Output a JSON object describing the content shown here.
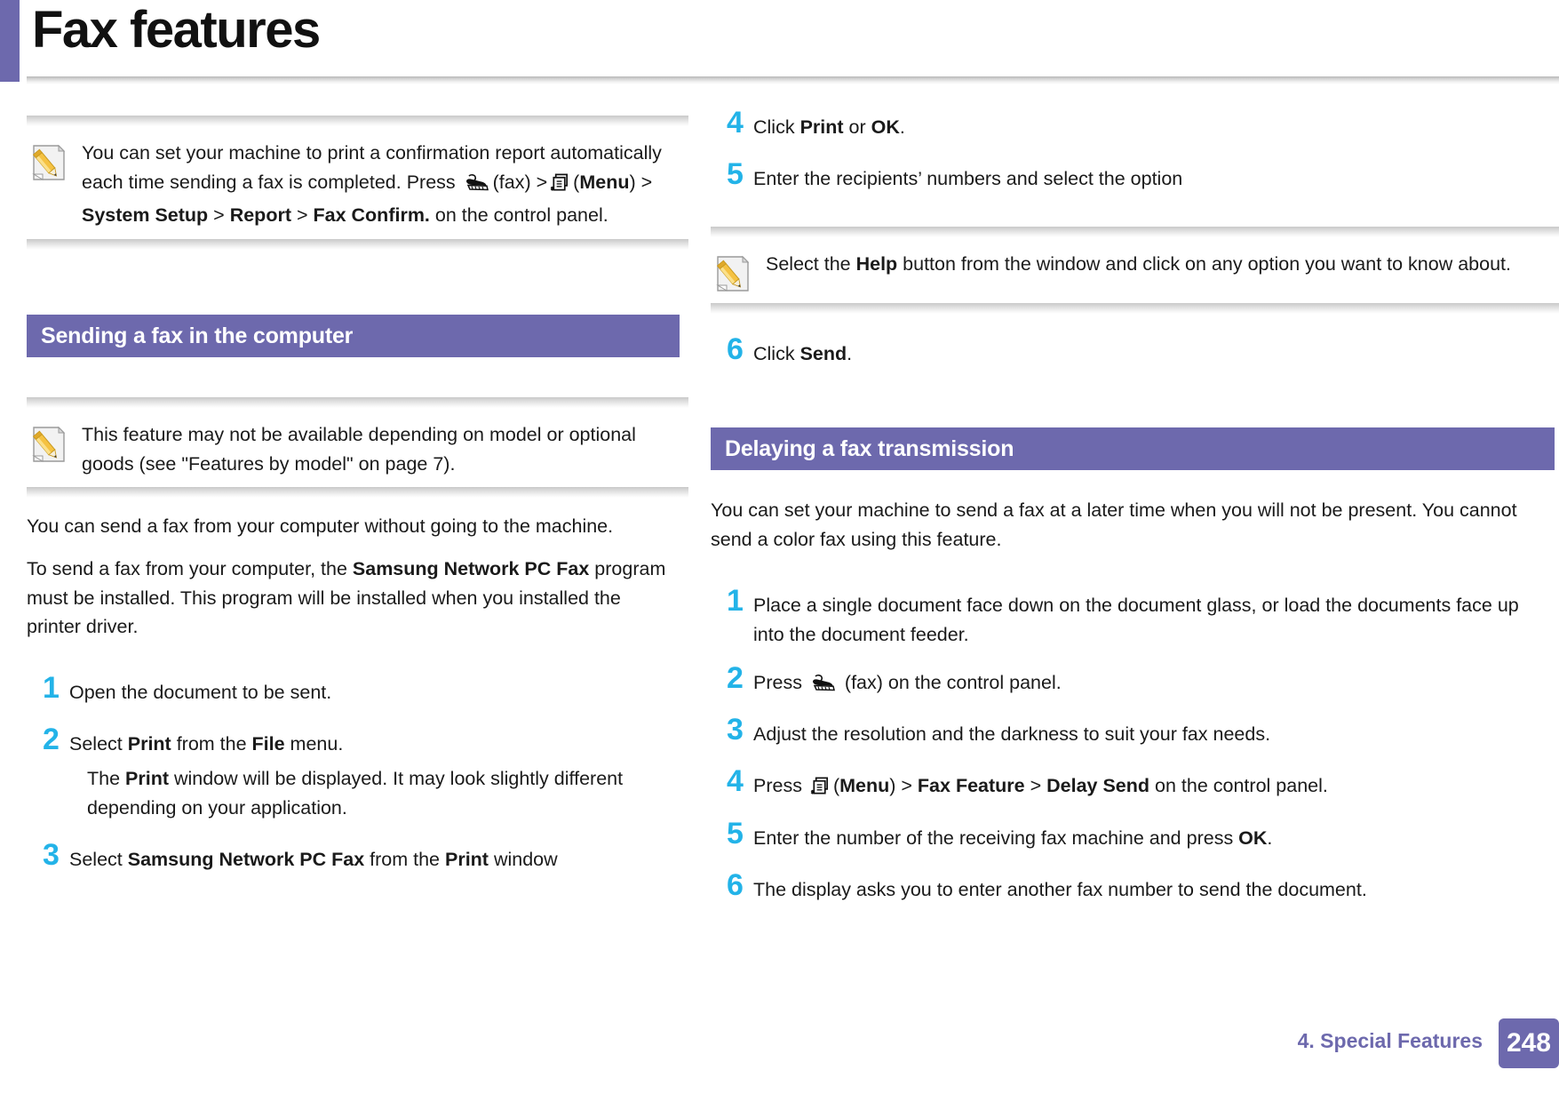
{
  "page": {
    "title": "Fax features",
    "accent_color": "#6d69ad",
    "step_number_color": "#23b3e8"
  },
  "notes": {
    "confirm_report": {
      "icon": "note-pencil-icon",
      "text_before_fax": "You can set your machine to print a confirmation report automatically each time sending a fax is completed. Press ",
      "fax_label": "(fax) >",
      "menu_label_open": "(",
      "menu_bold": "Menu",
      "menu_label_close": ") > ",
      "path_bold_1": "System Setup",
      "sep_1": " > ",
      "path_bold_2": "Report",
      "sep_2": " > ",
      "path_bold_3": "Fax Confirm.",
      "tail": " on the control panel."
    },
    "availability": {
      "icon": "note-pencil-icon",
      "text": "This feature may not be available depending on model or optional goods (see \"Features by model\" on page 7)."
    },
    "help_button": {
      "icon": "note-pencil-icon",
      "prefix": "Select the ",
      "bold": "Help",
      "suffix": " button from the window and click on any option you want to know about."
    }
  },
  "sections": {
    "sending_fax": {
      "heading": "Sending a fax in the computer",
      "paragraph_1": "You can send a fax from your computer without going to the machine.",
      "paragraph_2_prefix": "To send a fax from your computer, the ",
      "paragraph_2_bold": "Samsung Network PC Fax",
      "paragraph_2_suffix": " program must be installed. This program will be installed when you installed the printer driver.",
      "steps": [
        {
          "num": "1",
          "parts": [
            {
              "type": "plain",
              "text": "Open the document to be sent."
            }
          ]
        },
        {
          "num": "2",
          "parts": [
            {
              "type": "plain",
              "text": "Select "
            },
            {
              "type": "bold",
              "text": "Print"
            },
            {
              "type": "plain",
              "text": " from the "
            },
            {
              "type": "bold",
              "text": "File"
            },
            {
              "type": "plain",
              "text": " menu."
            }
          ]
        },
        {
          "num": "3",
          "parts": [
            {
              "type": "plain",
              "text": "Select "
            },
            {
              "type": "bold",
              "text": "Samsung Network PC Fax"
            },
            {
              "type": "plain",
              "text": " from the "
            },
            {
              "type": "bold",
              "text": "Print"
            },
            {
              "type": "plain",
              "text": " window"
            }
          ]
        },
        {
          "num": "4",
          "parts": [
            {
              "type": "plain",
              "text": "Click "
            },
            {
              "type": "bold",
              "text": "Print"
            },
            {
              "type": "plain",
              "text": " or "
            },
            {
              "type": "bold",
              "text": "OK"
            },
            {
              "type": "plain",
              "text": "."
            }
          ]
        },
        {
          "num": "5",
          "parts": [
            {
              "type": "plain",
              "text": "Enter the recipients’ numbers and select the option"
            }
          ]
        },
        {
          "num": "6",
          "parts": [
            {
              "type": "plain",
              "text": "Click "
            },
            {
              "type": "bold",
              "text": "Send"
            },
            {
              "type": "plain",
              "text": "."
            }
          ]
        }
      ],
      "substep_2_prefix": "The ",
      "substep_2_bold": "Print",
      "substep_2_suffix": " window will be displayed. It may look slightly different depending on your application."
    },
    "delaying_fax": {
      "heading": "Delaying a fax transmission",
      "paragraph": "You can set your machine to send a fax at a later time when you will not be present. You cannot send a color fax using this feature.",
      "steps": [
        {
          "num": "1",
          "text": "Place a single document face down on the document glass, or load the documents face up into the document feeder."
        },
        {
          "num": "2",
          "prefix": "Press ",
          "icon": "fax-machine-icon",
          "suffix": " (fax) on the control panel."
        },
        {
          "num": "3",
          "text": "Adjust the resolution and the darkness to suit your fax needs."
        },
        {
          "num": "4",
          "prefix": "Press ",
          "icon": "menu-icon",
          "menu_open": "(",
          "menu_bold": "Menu",
          "menu_close": ") > ",
          "bold_1": "Fax Feature",
          "sep": " > ",
          "bold_2": "Delay Send",
          "suffix": " on the control panel."
        },
        {
          "num": "5",
          "prefix": "Enter the number of the receiving fax machine and press ",
          "bold": "OK",
          "suffix": "."
        },
        {
          "num": "6",
          "text": "The display asks you to enter another fax number to send the document."
        }
      ]
    }
  },
  "footer": {
    "chapter_label": "4.  Special Features",
    "page_number": "248"
  }
}
